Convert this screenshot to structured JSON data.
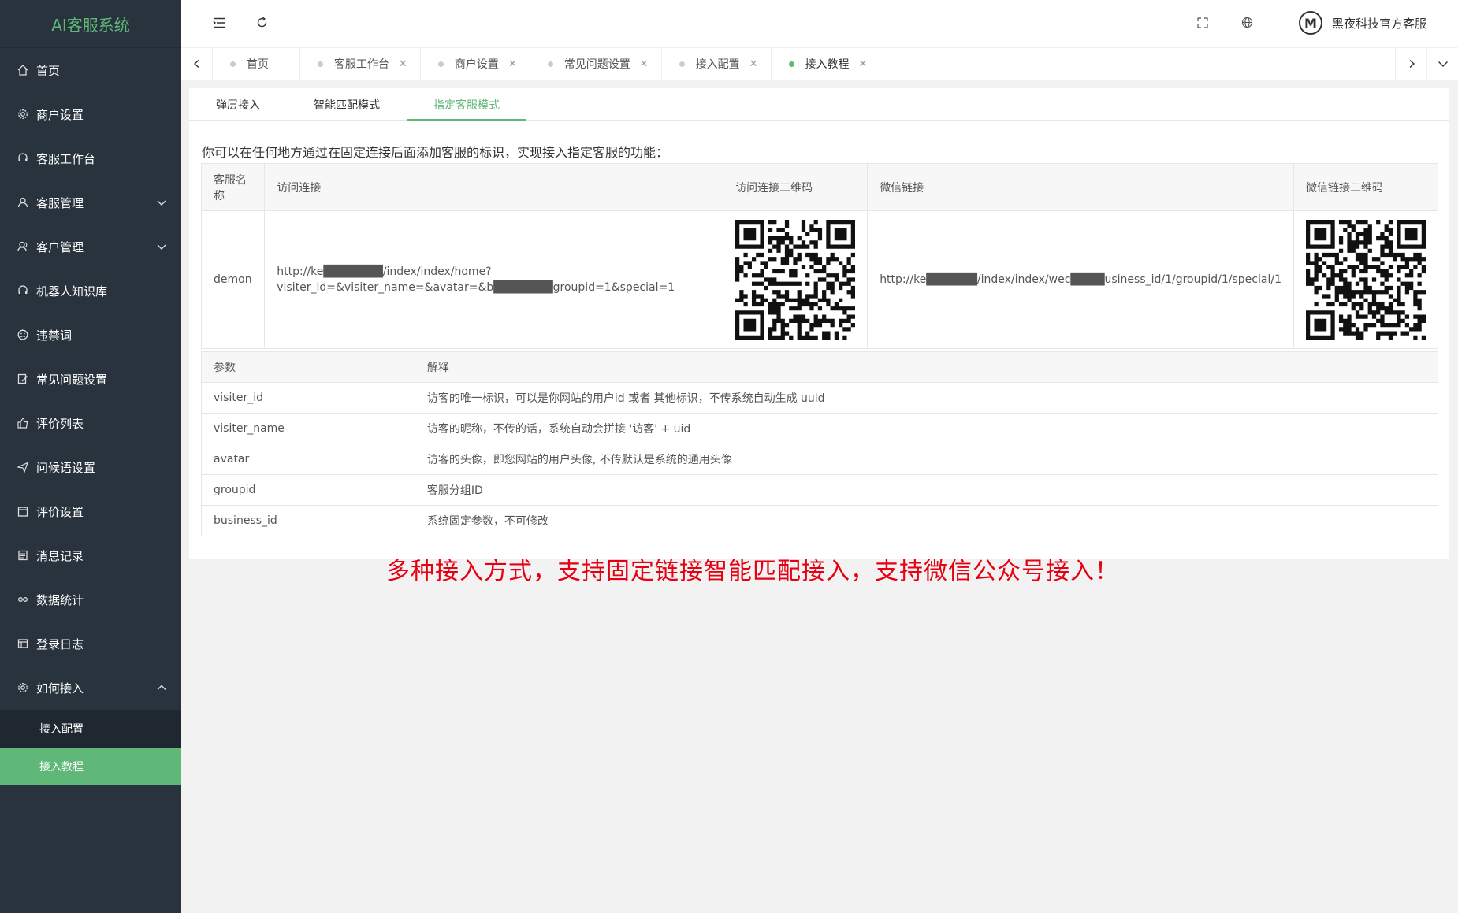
{
  "app": {
    "title": "AI客服系统"
  },
  "sidebar": {
    "items": [
      {
        "label": "首页",
        "icon": "home-icon"
      },
      {
        "label": "商户设置",
        "icon": "gear-icon"
      },
      {
        "label": "客服工作台",
        "icon": "headset-icon"
      },
      {
        "label": "客服管理",
        "icon": "user-icon"
      },
      {
        "label": "客户管理",
        "icon": "users-icon"
      },
      {
        "label": "机器人知识库",
        "icon": "robot-icon"
      },
      {
        "label": "违禁词",
        "icon": "frown-icon"
      },
      {
        "label": "常见问题设置",
        "icon": "edit-icon"
      },
      {
        "label": "评价列表",
        "icon": "thumb-up-icon"
      },
      {
        "label": "问候语设置",
        "icon": "send-icon"
      },
      {
        "label": "评价设置",
        "icon": "calendar-icon"
      },
      {
        "label": "消息记录",
        "icon": "document-icon"
      },
      {
        "label": "数据统计",
        "icon": "chart-icon"
      },
      {
        "label": "登录日志",
        "icon": "log-icon"
      },
      {
        "label": "如何接入",
        "icon": "plug-icon"
      }
    ],
    "sub_items": [
      {
        "label": "接入配置"
      },
      {
        "label": "接入教程"
      }
    ]
  },
  "header": {
    "user_name": "黑夜科技官方客服",
    "avatar_letter": "M"
  },
  "tabs": [
    {
      "label": "首页"
    },
    {
      "label": "客服工作台"
    },
    {
      "label": "商户设置"
    },
    {
      "label": "常见问题设置"
    },
    {
      "label": "接入配置"
    },
    {
      "label": "接入教程"
    }
  ],
  "subtabs": [
    {
      "label": "弹层接入"
    },
    {
      "label": "智能匹配模式"
    },
    {
      "label": "指定客服模式"
    }
  ],
  "intro": "你可以在任何地方通过在固定连接后面添加客服的标识，实现接入指定客服的功能：",
  "service_table": {
    "headers": [
      "客服名称",
      "访问连接",
      "访问连接二维码",
      "微信链接",
      "微信链接二维码"
    ],
    "row": {
      "name": "demon",
      "link_line1": "http://ke███████/index/index/home?",
      "link_line2": "visiter_id=&visiter_name=&avatar=&b███████groupid=1&special=1",
      "wechat_link": "http://ke██████/index/index/wec████usiness_id/1/groupid/1/special/1"
    }
  },
  "param_table": {
    "headers": [
      "参数",
      "解释"
    ],
    "rows": [
      {
        "param": "visiter_id",
        "desc": "访客的唯一标识，可以是你网站的用户id 或者 其他标识，不传系统自动生成 uuid"
      },
      {
        "param": "visiter_name",
        "desc": "访客的昵称，不传的话，系统自动会拼接 '访客' + uid"
      },
      {
        "param": "avatar",
        "desc": "访客的头像，即您网站的用户头像, 不传默认是系统的通用头像"
      },
      {
        "param": "groupid",
        "desc": "客服分组ID"
      },
      {
        "param": "business_id",
        "desc": "系统固定参数，不可修改"
      }
    ]
  },
  "slogan": "多种接入方式，支持固定链接智能匹配接入，支持微信公众号接入！",
  "colors": {
    "sidebar_bg": "#28333e",
    "accent": "#5fb878",
    "slogan": "#e60012"
  }
}
